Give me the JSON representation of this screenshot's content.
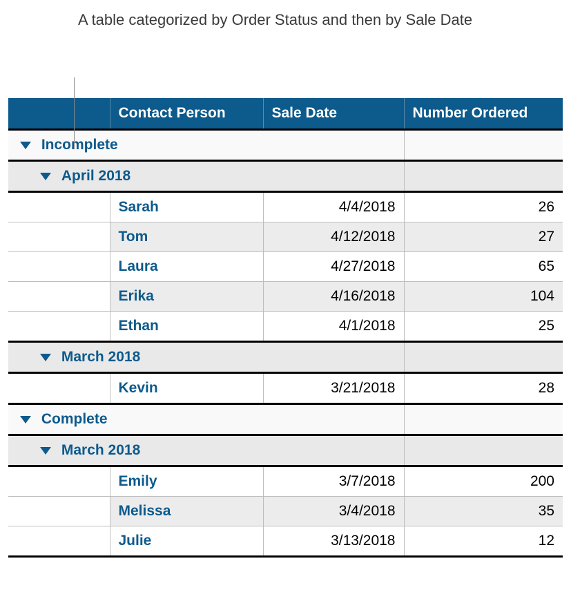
{
  "annotation": "A table categorized by Order Status and then by Sale Date",
  "columns": {
    "c1": "",
    "c2": "Contact Person",
    "c3": "Sale Date",
    "c4": "Number Ordered"
  },
  "groups": [
    {
      "status": "Incomplete",
      "months": [
        {
          "month": "April 2018",
          "rows": [
            {
              "contact": "Sarah",
              "date": "4/4/2018",
              "num": "26"
            },
            {
              "contact": "Tom",
              "date": "4/12/2018",
              "num": "27"
            },
            {
              "contact": "Laura",
              "date": "4/27/2018",
              "num": "65"
            },
            {
              "contact": "Erika",
              "date": "4/16/2018",
              "num": "104"
            },
            {
              "contact": "Ethan",
              "date": "4/1/2018",
              "num": "25"
            }
          ]
        },
        {
          "month": "March 2018",
          "rows": [
            {
              "contact": "Kevin",
              "date": "3/21/2018",
              "num": "28"
            }
          ]
        }
      ]
    },
    {
      "status": "Complete",
      "months": [
        {
          "month": "March 2018",
          "rows": [
            {
              "contact": "Emily",
              "date": "3/7/2018",
              "num": "200"
            },
            {
              "contact": "Melissa",
              "date": "3/4/2018",
              "num": "35"
            },
            {
              "contact": "Julie",
              "date": "3/13/2018",
              "num": "12"
            }
          ]
        }
      ]
    }
  ]
}
